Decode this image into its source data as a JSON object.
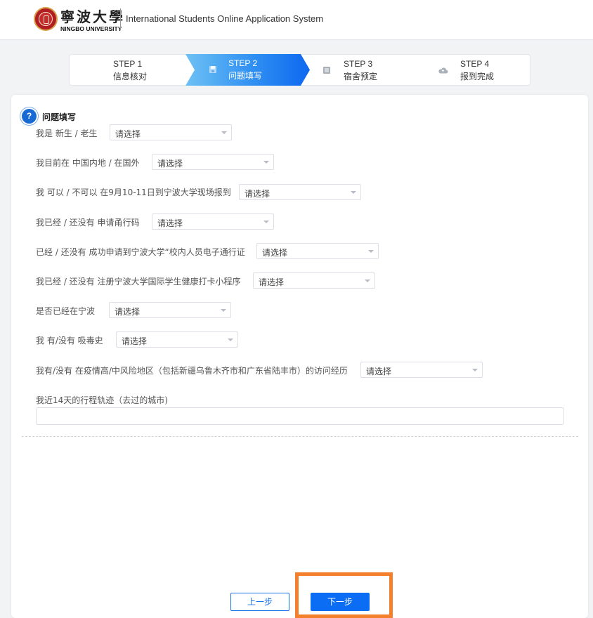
{
  "header": {
    "brand_cn": "寧波大學",
    "brand_en": "NINGBO UNIVERSITY",
    "system_title": "International Students Online Application System"
  },
  "steps": [
    {
      "title": "STEP 1",
      "subtitle": "信息核对",
      "icon": "none",
      "active": false
    },
    {
      "title": "STEP 2",
      "subtitle": "问题填写",
      "icon": "save-icon",
      "active": true
    },
    {
      "title": "STEP 3",
      "subtitle": "宿舍预定",
      "icon": "list-icon",
      "active": false
    },
    {
      "title": "STEP 4",
      "subtitle": "报到完成",
      "icon": "cloud-upload-icon",
      "active": false
    }
  ],
  "section": {
    "icon": "question-icon",
    "title": "问题填写"
  },
  "questions": [
    {
      "label": "我是 新生 / 老生",
      "value": "请选择"
    },
    {
      "label": "我目前在 中国内地 / 在国外",
      "value": "请选择"
    },
    {
      "label": "我 可以 / 不可以 在9月10-11日到宁波大学现场报到",
      "value": "请选择"
    },
    {
      "label": "我已经 / 还没有 申请甬行码",
      "value": "请选择"
    },
    {
      "label": "已经 / 还没有 成功申请到宁波大学“校内人员电子通行证",
      "value": "请选择"
    },
    {
      "label": "我已经 / 还没有 注册宁波大学国际学生健康打卡小程序",
      "value": "请选择"
    },
    {
      "label": "是否已经在宁波",
      "value": "请选择"
    },
    {
      "label": "我 有/没有 吸毒史",
      "value": "请选择"
    },
    {
      "label": "我有/没有 在疫情高/中风险地区（包括新疆乌鲁木齐市和广东省陆丰市）的访问经历",
      "value": "请选择"
    }
  ],
  "itinerary": {
    "label": "我近14天的行程轨迹（去过的城市)",
    "value": "",
    "placeholder": ""
  },
  "buttons": {
    "prev": "上一步",
    "next": "下一步"
  },
  "colors": {
    "brand_red": "#b01e23",
    "primary_blue": "#0b6df3",
    "highlight_orange": "#f47f2c"
  }
}
